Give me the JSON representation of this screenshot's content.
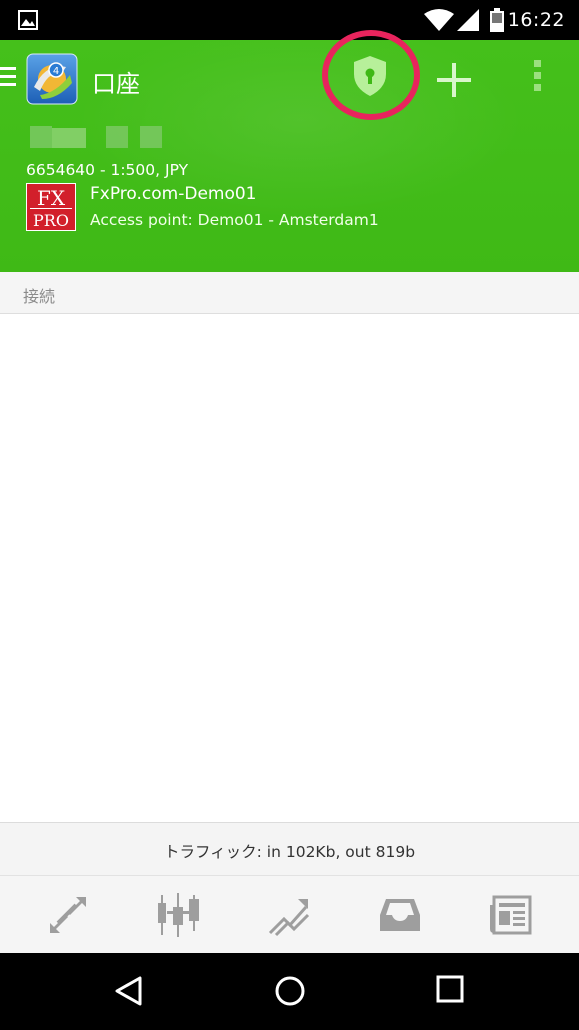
{
  "status_bar": {
    "time": "16:22",
    "icons": [
      "image-notification-icon",
      "wifi-icon",
      "signal-icon",
      "battery-icon"
    ]
  },
  "header": {
    "title": "口座",
    "actions": [
      "otp-shield-icon",
      "add-icon",
      "more-vert-icon"
    ],
    "highlight_color": "#e8245d",
    "background_color": "#43be19"
  },
  "account": {
    "number_leverage_currency": "6654640 - 1:500, JPY",
    "broker_logo_text": [
      "FX",
      "PRO"
    ],
    "server": "FxPro.com-Demo01",
    "access_point": "Access point: Demo01 - Amsterdam1"
  },
  "section": {
    "title": "接続"
  },
  "footer": {
    "traffic": "トラフィック: in 102Kb, out 819b"
  },
  "bottom_nav": [
    {
      "icon": "quotes-arrows-icon"
    },
    {
      "icon": "chart-candles-icon"
    },
    {
      "icon": "trade-trend-icon"
    },
    {
      "icon": "history-inbox-icon"
    },
    {
      "icon": "news-icon"
    }
  ],
  "system_nav": [
    "back-icon",
    "home-icon",
    "recents-icon"
  ]
}
